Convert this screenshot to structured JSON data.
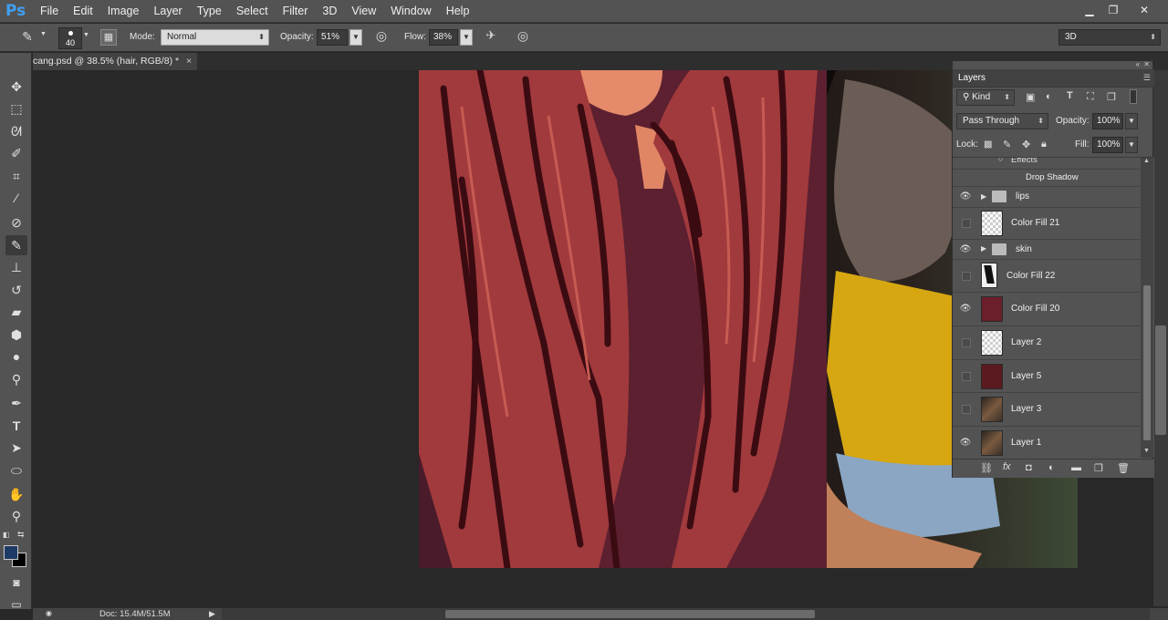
{
  "app": {
    "logo": "Ps"
  },
  "menu": [
    "File",
    "Edit",
    "Image",
    "Layer",
    "Type",
    "Select",
    "Filter",
    "3D",
    "View",
    "Window",
    "Help"
  ],
  "options": {
    "brush_size": "40",
    "mode_label": "Mode:",
    "mode_value": "Normal",
    "opacity_label": "Opacity:",
    "opacity_value": "51%",
    "flow_label": "Flow:",
    "flow_value": "38%",
    "workspace": "3D"
  },
  "document": {
    "tab_title": "cang.psd @ 38.5% (hair, RGB/8) *",
    "close": "×"
  },
  "status": {
    "doc_size": "Doc: 15.4M/51.5M"
  },
  "layers_panel": {
    "title": "Layers",
    "filter_kind": "Kind",
    "blend_mode": "Pass Through",
    "opacity_label": "Opacity:",
    "opacity_value": "100%",
    "lock_label": "Lock:",
    "fill_label": "Fill:",
    "fill_value": "100%",
    "effects_label": "Effects",
    "drop_shadow_label": "Drop Shadow",
    "layers": [
      {
        "name": "lips",
        "type": "group",
        "visible": true
      },
      {
        "name": "Color Fill 21",
        "type": "fill",
        "visible": false
      },
      {
        "name": "skin",
        "type": "group",
        "visible": true
      },
      {
        "name": "Color Fill 22",
        "type": "fill",
        "visible": false
      },
      {
        "name": "Color Fill 20",
        "type": "fill",
        "visible": true
      },
      {
        "name": "Layer 2",
        "type": "pixel",
        "visible": false
      },
      {
        "name": "Layer 5",
        "type": "pixel",
        "visible": false
      },
      {
        "name": "Layer 3",
        "type": "pixel",
        "visible": false
      },
      {
        "name": "Layer 1",
        "type": "pixel",
        "visible": true
      }
    ]
  },
  "colors": {
    "foreground": "#1e3a66",
    "background": "#000000",
    "layer5_fill": "#5a1a1f",
    "colorfill20": "#6a1f2a"
  }
}
